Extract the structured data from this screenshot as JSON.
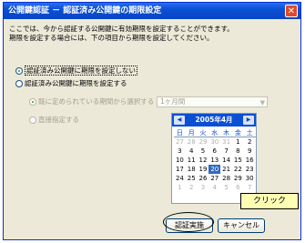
{
  "dialog": {
    "title": "公開鍵認証 － 認証済み公開鍵の期限設定",
    "close_glyph": "✕",
    "description_line1": "ここでは、今から認証する公開鍵に有効期限を設定することができます。",
    "description_line2": "期限を設定する場合には、下の項目から期限を設定してください。"
  },
  "options": {
    "no_limit": "認証済み公開鍵に期限を設定しない",
    "set_limit": "認証済み公開鍵に期限を設定する",
    "preset": "既に定められている期間から選択する",
    "direct": "直接指定する"
  },
  "period_select": {
    "value": "1ヶ月間",
    "arrow": "▼"
  },
  "calendar": {
    "month_label": "2005年4月",
    "prev": "◀",
    "next": "▶",
    "weekdays": [
      "日",
      "月",
      "火",
      "水",
      "木",
      "金",
      "土"
    ],
    "weeks": [
      [
        "27",
        "28",
        "29",
        "30",
        "31",
        "1",
        "2"
      ],
      [
        "3",
        "4",
        "5",
        "6",
        "7",
        "8",
        "9"
      ],
      [
        "10",
        "11",
        "12",
        "13",
        "14",
        "15",
        "16"
      ],
      [
        "17",
        "18",
        "19",
        "20",
        "21",
        "22",
        "23"
      ],
      [
        "24",
        "25",
        "26",
        "27",
        "28",
        "29",
        "30"
      ],
      [
        "1",
        "2",
        "3",
        "4",
        "5",
        "6",
        "7"
      ]
    ],
    "selected_day": "20"
  },
  "buttons": {
    "ok": "認証実施",
    "cancel": "キャンセル"
  },
  "annotation": {
    "callout": "クリック"
  }
}
